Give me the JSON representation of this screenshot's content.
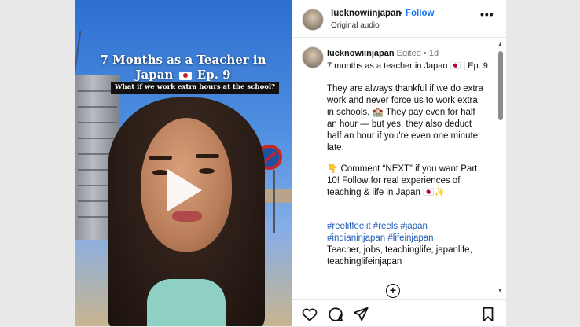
{
  "video": {
    "title_line1": "7 Months as a Teacher in",
    "title_line2_prefix": "Japan",
    "title_line2_suffix": "Ep. 9",
    "flag_icon": "japan-flag-icon",
    "subtitle": "What if we work extra hours at the school?"
  },
  "header": {
    "username": "lucknowiinjapan",
    "separator": "•",
    "follow_label": "Follow",
    "audio_label": "Original audio",
    "more_label": "•••"
  },
  "caption": {
    "username": "lucknowiinjapan",
    "edited": "Edited",
    "separator": "•",
    "age": "1d",
    "first_line": "7 months as a teacher in Japan 🇯🇵 | Ep. 9",
    "paragraph1": "They are always thankful if we do extra work and never force us to work extra in schools. 🏫 They pay even for half an hour — but yes, they also deduct half an hour if you're even one minute late.",
    "paragraph2": "👇 Comment “NEXT” if you want Part 10! Follow for real experiences of teaching & life in Japan 🇯🇵✨",
    "hashtags": "#reelitfeelit #reels #japan #indianinjapan #lifeinjapan",
    "keywords": "Teacher, jobs, teachinglife, japanlife, teachinglifeinjapan",
    "expand_label": "+"
  },
  "actions": {
    "icons": [
      "heart-icon",
      "comment-icon",
      "share-icon",
      "bookmark-icon"
    ]
  },
  "colors": {
    "link": "#1877f2",
    "hashtag": "#1f5bb4",
    "text": "#111111"
  }
}
